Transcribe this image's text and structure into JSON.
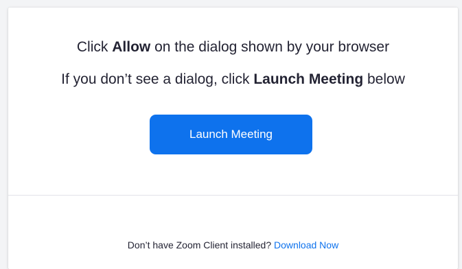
{
  "instructions": {
    "line1_prefix": "Click ",
    "line1_bold": "Allow",
    "line1_suffix": " on the dialog shown by your browser",
    "line2_prefix": "If you don’t see a dialog, click ",
    "line2_bold": "Launch Meeting",
    "line2_suffix": " below"
  },
  "launch_button": {
    "label": "Launch Meeting"
  },
  "footer": {
    "text": "Don’t have Zoom Client installed? ",
    "link_label": "Download Now"
  },
  "colors": {
    "primary": "#0e72ed",
    "text": "#232333",
    "background": "#ffffff"
  }
}
